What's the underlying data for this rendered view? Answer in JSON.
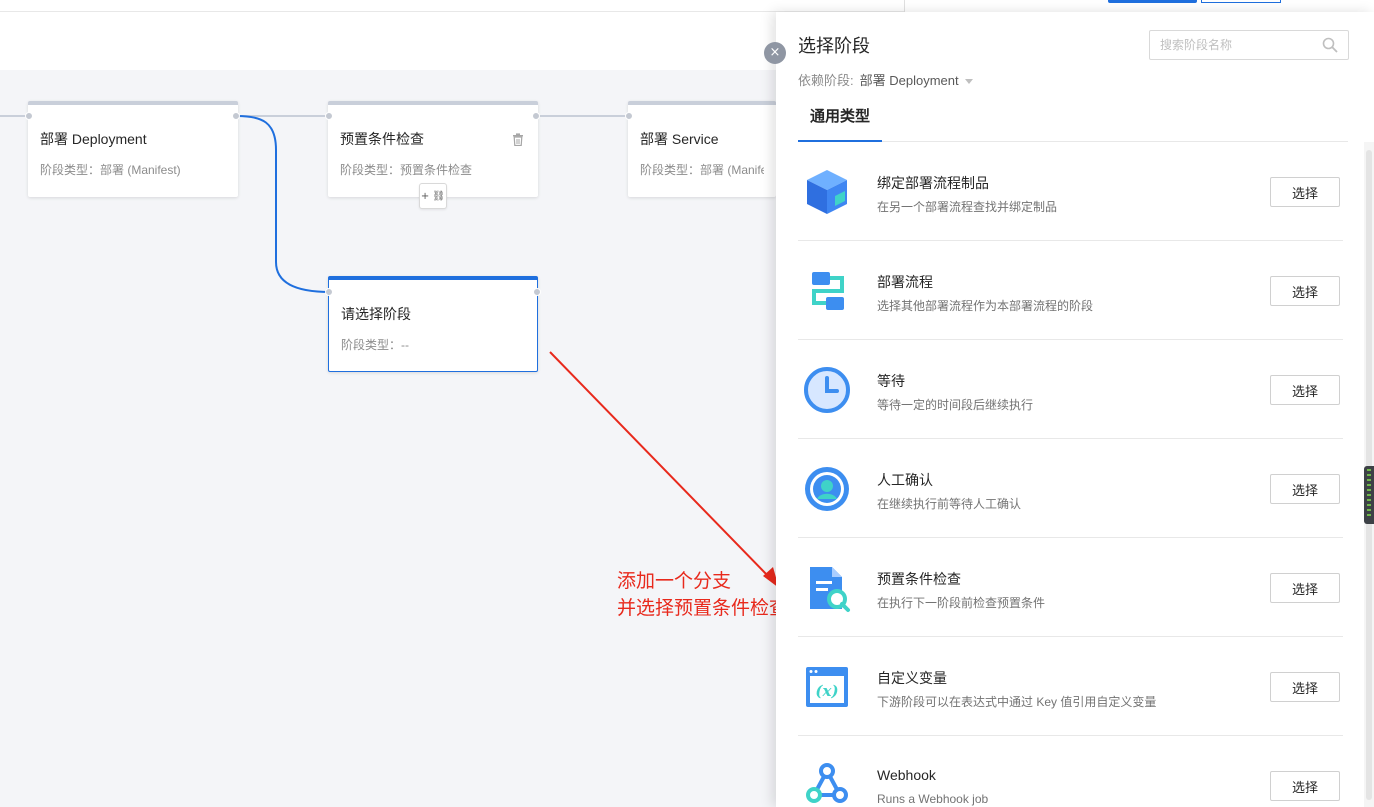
{
  "canvas": {
    "stages": [
      {
        "name": "部署 Deployment",
        "type": "阶段类型：部署 (Manifest)"
      },
      {
        "name": "预置条件检查",
        "type": "阶段类型：预置条件检查"
      },
      {
        "name": "部署 Service",
        "type": "阶段类型：部署 (Manifest)"
      },
      {
        "name": "请选择阶段",
        "type": "阶段类型：--"
      }
    ],
    "add_branch_label": "+ ⛓"
  },
  "annotation": {
    "line1": "添加一个分支",
    "line2": "并选择预置条件检查",
    "color": "#e8291c"
  },
  "drawer": {
    "close_label": "×",
    "title": "选择阶段",
    "search_placeholder": "搜索阶段名称",
    "dependency_label": "依赖阶段:",
    "dependency_value": "部署 Deployment",
    "tab": "通用类型",
    "items": [
      {
        "name": "绑定部署流程制品",
        "desc": "在另一个部署流程查找并绑定制品",
        "icon": "cube-icon",
        "button": "选择"
      },
      {
        "name": "部署流程",
        "desc": "选择其他部署流程作为本部署流程的阶段",
        "icon": "flow-icon",
        "button": "选择"
      },
      {
        "name": "等待",
        "desc": "等待一定的时间段后继续执行",
        "icon": "clock-icon",
        "button": "选择"
      },
      {
        "name": "人工确认",
        "desc": "在继续执行前等待人工确认",
        "icon": "user-icon",
        "button": "选择"
      },
      {
        "name": "预置条件检查",
        "desc": "在执行下一阶段前检查预置条件",
        "icon": "doc-search-icon",
        "button": "选择"
      },
      {
        "name": "自定义变量",
        "desc": "下游阶段可以在表达式中通过 Key 值引用自定义变量",
        "icon": "variable-icon",
        "button": "选择"
      },
      {
        "name": "Webhook",
        "desc": "Runs a Webhook job",
        "icon": "webhook-icon",
        "button": "选择"
      }
    ]
  },
  "colors": {
    "accent": "#1f6fde",
    "icon_blue": "#3d8ef0",
    "icon_teal": "#3fd3c8"
  }
}
